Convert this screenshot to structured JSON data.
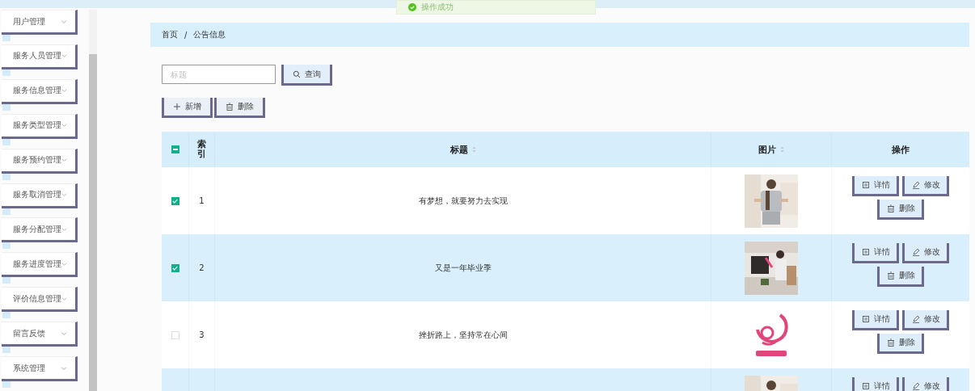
{
  "toast": {
    "text": "操作成功",
    "kind": "success"
  },
  "sidebar": {
    "items": [
      {
        "label": "用户管理",
        "expanded": false
      },
      {
        "label": "服务人员管理",
        "expanded": false
      },
      {
        "label": "服务信息管理",
        "expanded": false
      },
      {
        "label": "服务类型管理",
        "expanded": false
      },
      {
        "label": "服务预约管理",
        "expanded": false
      },
      {
        "label": "服务取消管理",
        "expanded": false
      },
      {
        "label": "服务分配管理",
        "expanded": false
      },
      {
        "label": "服务进度管理",
        "expanded": false
      },
      {
        "label": "评价信息管理",
        "expanded": false
      },
      {
        "label": "留言反馈",
        "expanded": false
      },
      {
        "label": "系统管理",
        "expanded": false
      }
    ]
  },
  "breadcrumb": [
    "首页",
    "/",
    "公告信息"
  ],
  "search": {
    "placeholder": "标题",
    "button": "查询"
  },
  "actions": [
    {
      "label": "新增",
      "kind": "add"
    },
    {
      "label": "删除",
      "kind": "delete"
    }
  ],
  "table": {
    "select_all": {
      "indeterminate": true
    },
    "columns": [
      {
        "label": "索引",
        "sortable": false
      },
      {
        "label": "标题",
        "sortable": true
      },
      {
        "label": "图片",
        "sortable": true
      },
      {
        "label": "操作",
        "sortable": false
      }
    ],
    "rows": [
      {
        "index": "1",
        "title": "有梦想，就要努力去实现",
        "selected": true,
        "picture": {
          "kind": "picture"
        },
        "buttons": [
          {
            "label": "详情",
            "kind": "detail"
          },
          {
            "label": "修改",
            "kind": "edit"
          },
          {
            "label": "删除",
            "kind": "delete"
          }
        ]
      },
      {
        "index": "2",
        "title": "又是一年毕业季",
        "selected": true,
        "picture": {
          "kind": "picture"
        },
        "buttons": [
          {
            "label": "详情",
            "kind": "detail"
          },
          {
            "label": "修改",
            "kind": "edit"
          },
          {
            "label": "删除",
            "kind": "delete"
          }
        ]
      },
      {
        "index": "3",
        "title": "挫折路上，坚持常在心间",
        "selected": false,
        "picture": {
          "kind": "picture"
        },
        "buttons": [
          {
            "label": "详情",
            "kind": "detail"
          },
          {
            "label": "修改",
            "kind": "edit"
          },
          {
            "label": "删除",
            "kind": "delete"
          }
        ]
      },
      {
        "picture": {
          "kind": "picture"
        },
        "buttons": [
          {
            "label": "详情",
            "kind": "detail"
          },
          {
            "label": "修改",
            "kind": "edit"
          }
        ]
      }
    ]
  }
}
